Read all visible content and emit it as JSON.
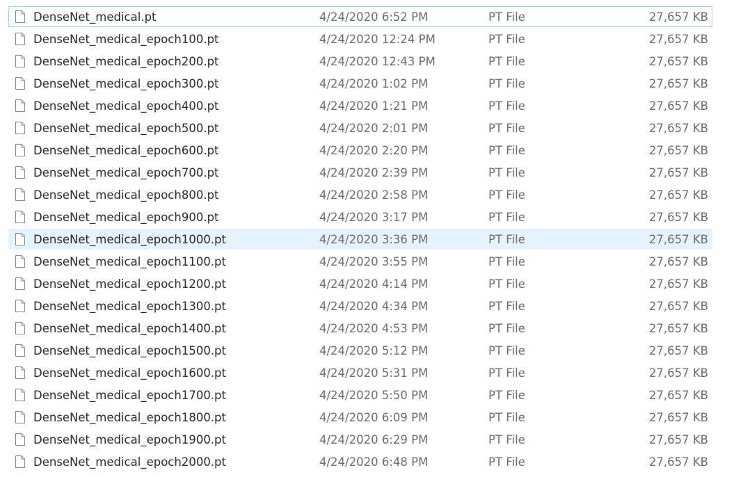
{
  "files": [
    {
      "name": "DenseNet_medical.pt",
      "date": "4/24/2020 6:52 PM",
      "type": "PT File",
      "size": "27,657 KB",
      "icon": "file-icon",
      "state": "focused"
    },
    {
      "name": "DenseNet_medical_epoch100.pt",
      "date": "4/24/2020 12:24 PM",
      "type": "PT File",
      "size": "27,657 KB",
      "icon": "file-icon",
      "state": ""
    },
    {
      "name": "DenseNet_medical_epoch200.pt",
      "date": "4/24/2020 12:43 PM",
      "type": "PT File",
      "size": "27,657 KB",
      "icon": "file-icon",
      "state": ""
    },
    {
      "name": "DenseNet_medical_epoch300.pt",
      "date": "4/24/2020 1:02 PM",
      "type": "PT File",
      "size": "27,657 KB",
      "icon": "file-icon",
      "state": ""
    },
    {
      "name": "DenseNet_medical_epoch400.pt",
      "date": "4/24/2020 1:21 PM",
      "type": "PT File",
      "size": "27,657 KB",
      "icon": "file-icon",
      "state": ""
    },
    {
      "name": "DenseNet_medical_epoch500.pt",
      "date": "4/24/2020 2:01 PM",
      "type": "PT File",
      "size": "27,657 KB",
      "icon": "file-icon",
      "state": ""
    },
    {
      "name": "DenseNet_medical_epoch600.pt",
      "date": "4/24/2020 2:20 PM",
      "type": "PT File",
      "size": "27,657 KB",
      "icon": "file-icon",
      "state": ""
    },
    {
      "name": "DenseNet_medical_epoch700.pt",
      "date": "4/24/2020 2:39 PM",
      "type": "PT File",
      "size": "27,657 KB",
      "icon": "file-icon",
      "state": ""
    },
    {
      "name": "DenseNet_medical_epoch800.pt",
      "date": "4/24/2020 2:58 PM",
      "type": "PT File",
      "size": "27,657 KB",
      "icon": "file-icon",
      "state": ""
    },
    {
      "name": "DenseNet_medical_epoch900.pt",
      "date": "4/24/2020 3:17 PM",
      "type": "PT File",
      "size": "27,657 KB",
      "icon": "file-icon",
      "state": ""
    },
    {
      "name": "DenseNet_medical_epoch1000.pt",
      "date": "4/24/2020 3:36 PM",
      "type": "PT File",
      "size": "27,657 KB",
      "icon": "file-icon",
      "state": "hover"
    },
    {
      "name": "DenseNet_medical_epoch1100.pt",
      "date": "4/24/2020 3:55 PM",
      "type": "PT File",
      "size": "27,657 KB",
      "icon": "file-icon",
      "state": ""
    },
    {
      "name": "DenseNet_medical_epoch1200.pt",
      "date": "4/24/2020 4:14 PM",
      "type": "PT File",
      "size": "27,657 KB",
      "icon": "file-icon",
      "state": ""
    },
    {
      "name": "DenseNet_medical_epoch1300.pt",
      "date": "4/24/2020 4:34 PM",
      "type": "PT File",
      "size": "27,657 KB",
      "icon": "file-icon",
      "state": ""
    },
    {
      "name": "DenseNet_medical_epoch1400.pt",
      "date": "4/24/2020 4:53 PM",
      "type": "PT File",
      "size": "27,657 KB",
      "icon": "file-icon",
      "state": ""
    },
    {
      "name": "DenseNet_medical_epoch1500.pt",
      "date": "4/24/2020 5:12 PM",
      "type": "PT File",
      "size": "27,657 KB",
      "icon": "file-icon",
      "state": ""
    },
    {
      "name": "DenseNet_medical_epoch1600.pt",
      "date": "4/24/2020 5:31 PM",
      "type": "PT File",
      "size": "27,657 KB",
      "icon": "file-icon",
      "state": ""
    },
    {
      "name": "DenseNet_medical_epoch1700.pt",
      "date": "4/24/2020 5:50 PM",
      "type": "PT File",
      "size": "27,657 KB",
      "icon": "file-icon",
      "state": ""
    },
    {
      "name": "DenseNet_medical_epoch1800.pt",
      "date": "4/24/2020 6:09 PM",
      "type": "PT File",
      "size": "27,657 KB",
      "icon": "file-icon",
      "state": ""
    },
    {
      "name": "DenseNet_medical_epoch1900.pt",
      "date": "4/24/2020 6:29 PM",
      "type": "PT File",
      "size": "27,657 KB",
      "icon": "file-icon",
      "state": ""
    },
    {
      "name": "DenseNet_medical_epoch2000.pt",
      "date": "4/24/2020 6:48 PM",
      "type": "PT File",
      "size": "27,657 KB",
      "icon": "file-icon",
      "state": ""
    }
  ],
  "colors": {
    "focus_border": "#99d1ff",
    "hover_background": "#e5f3ff",
    "name_text": "#2b2b2b",
    "detail_text": "#6d6d6d"
  }
}
